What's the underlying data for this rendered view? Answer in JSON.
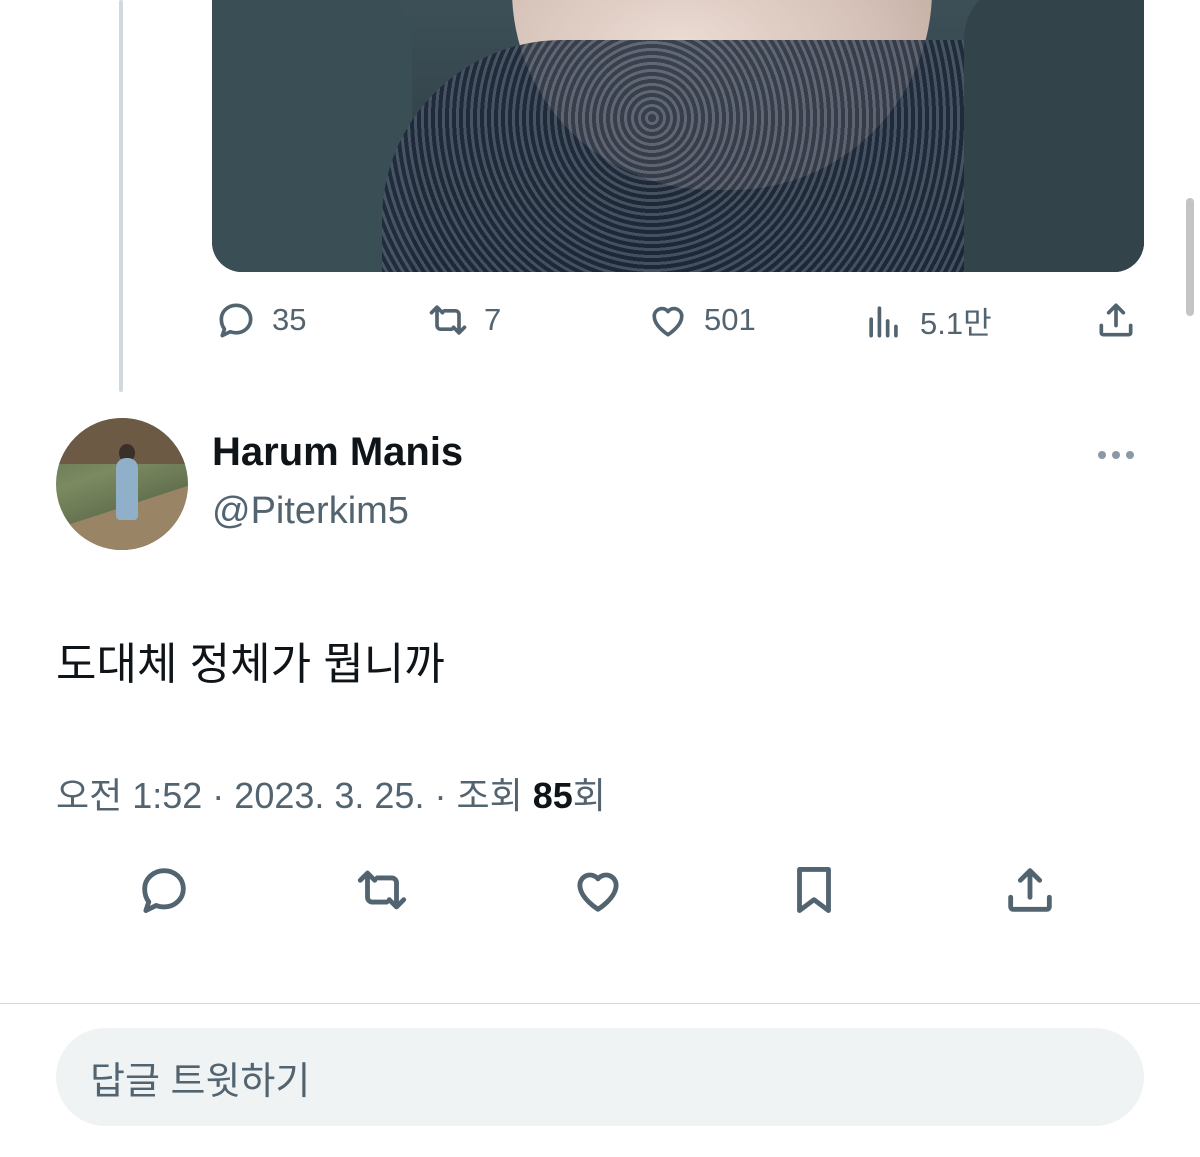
{
  "parent_tweet": {
    "stats": {
      "replies": "35",
      "retweets": "7",
      "likes": "501",
      "views": "5.1만"
    }
  },
  "reply": {
    "author_name": "Harum Manis",
    "author_handle": "@Piterkim5",
    "text": "도대체 정체가 뭡니까",
    "meta_prefix": "오전 1:52 · 2023. 3. 25. · 조회 ",
    "views_count": "85",
    "views_suffix": "회"
  },
  "compose": {
    "placeholder": "답글 트윗하기"
  },
  "icons": [
    "reply-icon",
    "retweet-icon",
    "like-icon",
    "views-icon",
    "share-icon",
    "bookmark-icon",
    "more-icon"
  ],
  "colors": {
    "muted": "#536471",
    "text": "#0f1419",
    "divider": "#cfd9de",
    "input_bg": "#eff3f4"
  }
}
